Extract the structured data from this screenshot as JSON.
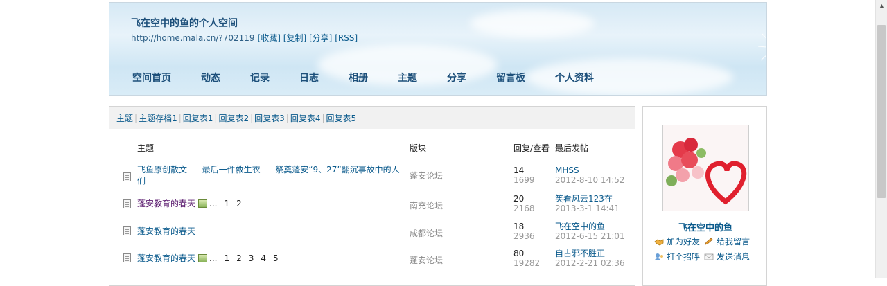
{
  "header": {
    "site_title": "飞在空中的鱼的个人空间",
    "url": "http://home.mala.cn/?702119",
    "links": [
      "[收藏]",
      "[复制]",
      "[分享]",
      "[RSS]"
    ],
    "nav": [
      "空间首页",
      "动态",
      "记录",
      "日志",
      "相册",
      "主题",
      "分享",
      "留言板",
      "个人资料"
    ]
  },
  "tabs": [
    "主题",
    "主题存档1",
    "回复表1",
    "回复表2",
    "回复表3",
    "回复表4",
    "回复表5"
  ],
  "table": {
    "columns": {
      "topic": "主题",
      "forum": "版块",
      "replies_views": "回复/查看",
      "last_post": "最后发帖"
    },
    "rows": [
      {
        "title": "飞鱼原创散文-----最后一件救生衣-----祭奠蓬安“9、27”翻沉事故中的人们",
        "forum": "蓬安论坛",
        "replies": "14",
        "views": "1699",
        "last_user": "MHSS",
        "last_time": "2012-8-10 14:52",
        "pages": [],
        "has_image": false
      },
      {
        "title": "蓬安教育的春天",
        "forum": "南充论坛",
        "replies": "20",
        "views": "2168",
        "last_user": "笑看风云123在",
        "last_time": "2013-3-1 14:41",
        "pages": [
          "...",
          "1",
          "2"
        ],
        "has_image": true
      },
      {
        "title": "蓬安教育的春天",
        "forum": "成都论坛",
        "replies": "18",
        "views": "2936",
        "last_user": "飞在空中的鱼",
        "last_time": "2012-6-15 21:01",
        "pages": [],
        "has_image": false
      },
      {
        "title": "蓬安教育的春天",
        "forum": "蓬安论坛",
        "replies": "80",
        "views": "19282",
        "last_user": "自古邪不胜正",
        "last_time": "2012-2-21 02:36",
        "pages": [
          "...",
          "1",
          "2",
          "3",
          "4",
          "5"
        ],
        "has_image": true
      }
    ]
  },
  "profile": {
    "name": "飞在空中的鱼",
    "actions": [
      "加为好友",
      "给我留言",
      "打个招呼",
      "发送消息"
    ]
  },
  "colors": {
    "link": "#0a5a8c",
    "banner": "#d6e9f5",
    "visited": "#5a1a6e"
  }
}
